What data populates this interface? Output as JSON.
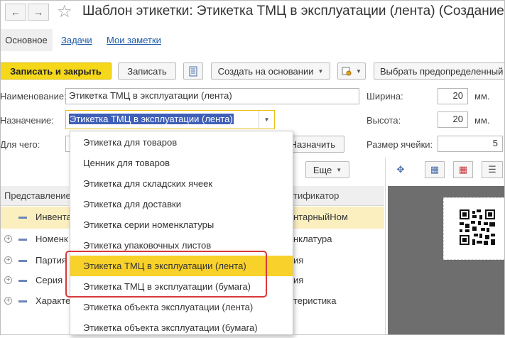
{
  "window": {
    "title": "Шаблон этикетки: Этикетка ТМЦ в эксплуатации (лента) (Создание)"
  },
  "nav": {
    "back": "←",
    "forward": "→",
    "star": "☆"
  },
  "tabs": [
    {
      "label": "Основное"
    },
    {
      "label": "Задачи"
    },
    {
      "label": "Мои заметки"
    }
  ],
  "toolbar": {
    "save_close": "Записать и закрыть",
    "save": "Записать",
    "create_basis": "Создать на основании",
    "predefined": "Выбрать предопределенный"
  },
  "form": {
    "name_label": "Наименование:",
    "name_value": "Этикетка ТМЦ в эксплуатации (лента)",
    "purpose_label": "Назначение:",
    "purpose_value": "Этикетка ТМЦ в эксплуатации (лента)",
    "for_what_label": "Для чего:",
    "assign_button": "Назначить",
    "width_label": "Ширина:",
    "width_value": "20",
    "width_unit": "мм.",
    "height_label": "Высота:",
    "height_value": "20",
    "height_unit": "мм.",
    "cell_label": "Размер ячейки:",
    "cell_value": "5"
  },
  "table": {
    "more_button": "Еще",
    "col_presentation": "Представление",
    "col_identifier": "тификатор",
    "rows": [
      {
        "name": "Инвента",
        "id": "нтарныйНом",
        "expander": ""
      },
      {
        "name": "Номенк",
        "id": "нклатура",
        "expander": "+"
      },
      {
        "name": "Партия",
        "id": "ия",
        "expander": "+"
      },
      {
        "name": "Серия",
        "id": "ия",
        "expander": "+"
      },
      {
        "name": "Характе",
        "id": "теристика",
        "expander": "+"
      }
    ]
  },
  "dropdown": {
    "options": [
      "Этикетка для товаров",
      "Ценник для товаров",
      "Этикетка для складских ячеек",
      "Этикетка для доставки",
      "Этикетка серии номенклатуры",
      "Этикетка упаковочных листов",
      "Этикетка ТМЦ в эксплуатации (лента)",
      "Этикетка ТМЦ в эксплуатации (бумага)",
      "Этикетка объекта эксплуатации (лента)",
      "Этикетка объекта эксплуатации (бумага)"
    ],
    "active_index": 6
  },
  "icons": {
    "move": "✥",
    "grid": "▦",
    "grid_red": "▦",
    "align": "☰"
  },
  "colors": {
    "accent": "#f5d81a",
    "selection": "#f8d12a",
    "highlight_box": "#d8383a",
    "link": "#1c5aa6"
  }
}
